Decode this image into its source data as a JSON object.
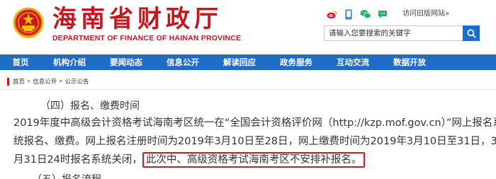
{
  "header": {
    "title": "海南省财政厅",
    "subtitle": "DEPARTMENT OF FINANCE OF HAINAN PROVINCE",
    "old_site_label": "访问旧版网站»",
    "search_placeholder": "请输入您要搜索的关键字",
    "brand_color": "#c8161d",
    "top_icons": [
      "weibo-icon",
      "mobile-icon",
      "wechat-icon",
      "chat-icon"
    ]
  },
  "nav": {
    "color": "#1f6dc7",
    "items": [
      "首页",
      "机构介绍",
      "要闻动态",
      "信息公开",
      "解读回应",
      "政务服务",
      "互动交流",
      "数据开放"
    ]
  },
  "breadcrumb": {
    "home": "首页",
    "sep1": "»",
    "level1": "信息公开",
    "sep2": "»",
    "level2": "公示公告"
  },
  "article": {
    "section_heading": "（四）报名、缴费时间",
    "para_line1": "2019年度中高级会计资格考试海南考区统一在“全国会计资格评价网（http://kzp.mof.gov.cn）”网上报名系",
    "para_line2": "统报名、缴费。网上报名注册时间为2019年3月10日至28日，网上缴费时间为2019年3月10日至31日，3",
    "para_line3_prefix": "月31日24时报名系统关闭，",
    "para_line3_highlight": "此次中、高级资格考试海南考区不安排补报名。",
    "next_heading": "（五）报名流程",
    "highlight_color": "#d21b1b"
  }
}
